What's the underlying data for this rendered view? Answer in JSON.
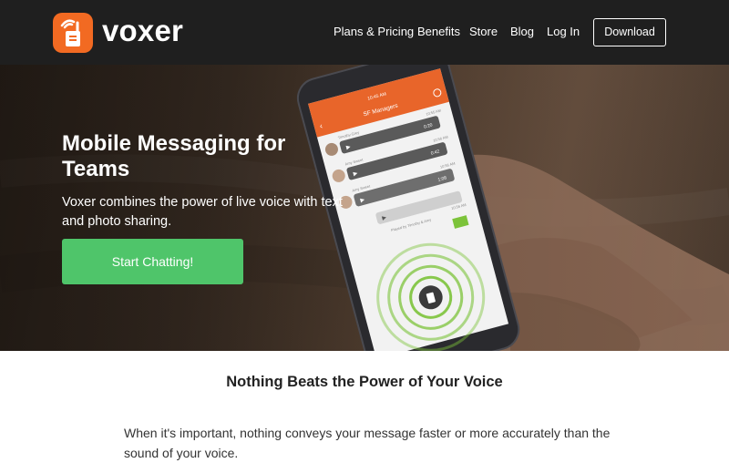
{
  "brand": {
    "name": "voxer",
    "color": "#f26a22"
  },
  "nav": {
    "plans": "Plans & Pricing",
    "benefits": "Benefits",
    "store": "Store",
    "blog": "Blog",
    "login": "Log In",
    "download": "Download"
  },
  "hero": {
    "title": "Mobile Messaging for Teams",
    "subtitle": "Voxer combines the power of live voice with text and photo sharing.",
    "cta": "Start Chatting!",
    "cta_color": "#4fc56a"
  },
  "phone": {
    "channel": "SF Managers",
    "status_time": "10:45 AM",
    "messages": [
      {
        "sender": "Timothy Grey",
        "time": "10:55 AM",
        "duration": "0:20"
      },
      {
        "sender": "Amy Sweet",
        "time": "10:56 AM",
        "duration": "0:42"
      },
      {
        "sender": "Amy Sweet",
        "time": "10:56 AM",
        "duration": "1:08"
      }
    ],
    "outgoing_time": "10:56 AM",
    "played_by": "Played by Timothy & Amy",
    "accent": "#e8652a",
    "talk_color": "#7cc33a"
  },
  "section": {
    "title": "Nothing Beats the Power of Your Voice",
    "body": "When it's important, nothing conveys your message faster or more accurately than the sound of your voice."
  }
}
